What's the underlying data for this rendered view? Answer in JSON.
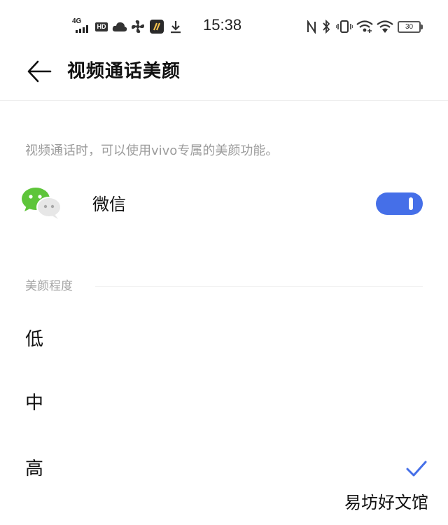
{
  "status_bar": {
    "network": "4G",
    "hd_badge": "HD",
    "time": "15:38",
    "battery": "30"
  },
  "header": {
    "title": "视频通话美颜"
  },
  "description": "视频通话时，可以使用vivo专属的美颜功能。",
  "apps": [
    {
      "label": "微信",
      "icon": "wechat-icon",
      "enabled": true
    }
  ],
  "section": {
    "title": "美颜程度"
  },
  "levels": [
    {
      "label": "低",
      "selected": false
    },
    {
      "label": "中",
      "selected": false
    },
    {
      "label": "高",
      "selected": true
    }
  ],
  "watermark": "易坊好文馆",
  "colors": {
    "accent": "#456fe8",
    "wechat_green": "#5ec53a",
    "secondary_text": "#9b9b9b"
  }
}
